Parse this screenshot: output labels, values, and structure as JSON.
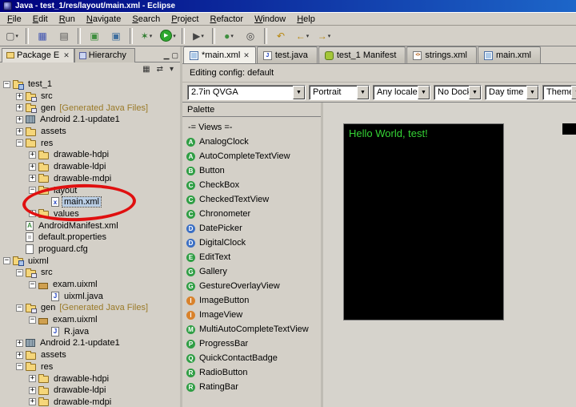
{
  "window": {
    "title": "Java - test_1/res/layout/main.xml - Eclipse"
  },
  "menubar": {
    "items": [
      "File",
      "Edit",
      "Run",
      "Navigate",
      "Search",
      "Project",
      "Refactor",
      "Window",
      "Help"
    ]
  },
  "toolbar": {
    "buttons": [
      {
        "kind": "button",
        "name": "new-wizard-button",
        "glyph": "▢",
        "color": "#555555",
        "dropdown": true
      },
      {
        "kind": "sep",
        "name": "toolbar-separator",
        "interactable": false
      },
      {
        "kind": "button",
        "name": "save-button",
        "glyph": "▦",
        "color": "#3a4fb0"
      },
      {
        "kind": "button",
        "name": "print-button",
        "glyph": "▤",
        "color": "#555555"
      },
      {
        "kind": "sep",
        "name": "toolbar-separator",
        "interactable": false
      },
      {
        "kind": "button",
        "name": "android-sdk-manager-button",
        "glyph": "▣",
        "color": "#3f8f3f"
      },
      {
        "kind": "button",
        "name": "android-avd-manager-button",
        "glyph": "▣",
        "color": "#3f6f9f"
      },
      {
        "kind": "sep",
        "name": "toolbar-separator",
        "interactable": false
      },
      {
        "kind": "button",
        "name": "debug-button",
        "glyph": "✶",
        "color": "#2f7d2f",
        "dropdown": true
      },
      {
        "kind": "button",
        "name": "run-button",
        "glyph": "▶",
        "color": "#ffffff",
        "bg": "#2ea82e",
        "circle": true,
        "dropdown": true
      },
      {
        "kind": "sep",
        "name": "toolbar-separator",
        "interactable": false
      },
      {
        "kind": "button",
        "name": "external-tools-button",
        "glyph": "▶",
        "color": "#444444",
        "dropdown": true
      },
      {
        "kind": "sep",
        "name": "toolbar-separator",
        "interactable": false
      },
      {
        "kind": "button",
        "name": "new-java-element-button",
        "glyph": "●",
        "color": "#3f8f3f",
        "dropdown": true
      },
      {
        "kind": "button",
        "name": "search-button",
        "glyph": "◎",
        "color": "#444444"
      },
      {
        "kind": "sep",
        "name": "toolbar-separator",
        "interactable": false
      },
      {
        "kind": "button",
        "name": "last-edit-location-button",
        "glyph": "↶",
        "color": "#b8860b"
      },
      {
        "kind": "button",
        "name": "back-button",
        "glyph": "←",
        "color": "#b8860b",
        "dropdown": true
      },
      {
        "kind": "button",
        "name": "forward-button",
        "glyph": "→",
        "color": "#b8860b",
        "dropdown": true
      }
    ]
  },
  "package_explorer": {
    "tabs": [
      {
        "label": "Package E",
        "icon": "package-explorer",
        "active": true,
        "close": "✕"
      },
      {
        "label": "Hierarchy",
        "icon": "hierarchy",
        "active": false
      }
    ],
    "controls": [
      {
        "name": "minimize-icon",
        "glyph": "▁"
      },
      {
        "name": "maximize-icon",
        "glyph": "▢"
      }
    ],
    "toolbar": [
      {
        "name": "collapse-all-icon",
        "glyph": "▦"
      },
      {
        "name": "link-with-editor-icon",
        "glyph": "⇄"
      },
      {
        "name": "view-menu-icon",
        "glyph": "▾"
      }
    ],
    "tree": [
      {
        "label": "test_1",
        "depth": 0,
        "expander": "minus",
        "icon": "project"
      },
      {
        "label": "src",
        "depth": 1,
        "expander": "plus",
        "icon": "srcfolder"
      },
      {
        "label": "gen",
        "suffix": "[Generated Java Files]",
        "depth": 1,
        "expander": "plus",
        "icon": "srcfolder"
      },
      {
        "label": "Android 2.1-update1",
        "depth": 1,
        "expander": "plus",
        "icon": "library"
      },
      {
        "label": "assets",
        "depth": 1,
        "expander": "plus",
        "icon": "folder"
      },
      {
        "label": "res",
        "depth": 1,
        "expander": "minus",
        "icon": "folder"
      },
      {
        "label": "drawable-hdpi",
        "depth": 2,
        "expander": "plus",
        "icon": "folder"
      },
      {
        "label": "drawable-ldpi",
        "depth": 2,
        "expander": "plus",
        "icon": "folder"
      },
      {
        "label": "drawable-mdpi",
        "depth": 2,
        "expander": "plus",
        "icon": "folder"
      },
      {
        "label": "layout",
        "depth": 2,
        "expander": "minus",
        "icon": "folder"
      },
      {
        "label": "main.xml",
        "depth": 3,
        "expander": "none",
        "icon": "xml",
        "selected": true
      },
      {
        "label": "values",
        "depth": 2,
        "expander": "plus",
        "icon": "folder"
      },
      {
        "label": "AndroidManifest.xml",
        "depth": 1,
        "expander": "none",
        "icon": "manifest"
      },
      {
        "label": "default.properties",
        "depth": 1,
        "expander": "none",
        "icon": "properties"
      },
      {
        "label": "proguard.cfg",
        "depth": 1,
        "expander": "none",
        "icon": "file"
      },
      {
        "label": "uixml",
        "depth": 0,
        "expander": "minus",
        "icon": "project"
      },
      {
        "label": "src",
        "depth": 1,
        "expander": "minus",
        "icon": "srcfolder"
      },
      {
        "label": "exam.uixml",
        "depth": 2,
        "expander": "minus",
        "icon": "package"
      },
      {
        "label": "uixml.java",
        "depth": 3,
        "expander": "none",
        "icon": "java"
      },
      {
        "label": "gen",
        "suffix": "[Generated Java Files]",
        "depth": 1,
        "expander": "minus",
        "icon": "srcfolder"
      },
      {
        "label": "exam.uixml",
        "depth": 2,
        "expander": "minus",
        "icon": "package"
      },
      {
        "label": "R.java",
        "depth": 3,
        "expander": "none",
        "icon": "java"
      },
      {
        "label": "Android 2.1-update1",
        "depth": 1,
        "expander": "plus",
        "icon": "library"
      },
      {
        "label": "assets",
        "depth": 1,
        "expander": "plus",
        "icon": "folder"
      },
      {
        "label": "res",
        "depth": 1,
        "expander": "minus",
        "icon": "folder"
      },
      {
        "label": "drawable-hdpi",
        "depth": 2,
        "expander": "plus",
        "icon": "folder"
      },
      {
        "label": "drawable-ldpi",
        "depth": 2,
        "expander": "plus",
        "icon": "folder"
      },
      {
        "label": "drawable-mdpi",
        "depth": 2,
        "expander": "plus",
        "icon": "folder"
      }
    ]
  },
  "editor": {
    "tabs": [
      {
        "label": "*main.xml",
        "icon": "layout",
        "active": true,
        "close": "✕"
      },
      {
        "label": "test.java",
        "icon": "java",
        "active": false
      },
      {
        "label": "test_1 Manifest",
        "icon": "android",
        "active": false
      },
      {
        "label": "strings.xml",
        "icon": "xml",
        "active": false
      },
      {
        "label": "main.xml",
        "icon": "layout",
        "active": false
      }
    ],
    "config_label": "Editing config: default",
    "combos": [
      {
        "name": "device-config-combo",
        "value": "2.7in QVGA"
      },
      {
        "name": "orientation-combo",
        "value": "Portrait"
      },
      {
        "name": "locale-combo",
        "value": "Any locale"
      },
      {
        "name": "dock-combo",
        "value": "No Dock"
      },
      {
        "name": "time-combo",
        "value": "Day time"
      },
      {
        "name": "theme-combo",
        "value": "Theme"
      }
    ]
  },
  "palette": {
    "title": "Palette",
    "items": [
      {
        "kind": "header",
        "label": "-= Views =-"
      },
      {
        "kind": "widget",
        "label": "AnalogClock",
        "letter": "A",
        "color": "#2f9e44"
      },
      {
        "kind": "widget",
        "label": "AutoCompleteTextView",
        "letter": "A",
        "color": "#2f9e44"
      },
      {
        "kind": "widget",
        "label": "Button",
        "letter": "B",
        "color": "#2f9e44"
      },
      {
        "kind": "widget",
        "label": "CheckBox",
        "letter": "C",
        "color": "#2f9e44"
      },
      {
        "kind": "widget",
        "label": "CheckedTextView",
        "letter": "C",
        "color": "#2f9e44"
      },
      {
        "kind": "widget",
        "label": "Chronometer",
        "letter": "C",
        "color": "#2f9e44"
      },
      {
        "kind": "widget",
        "label": "DatePicker",
        "letter": "D",
        "color": "#3b6fc4"
      },
      {
        "kind": "widget",
        "label": "DigitalClock",
        "letter": "D",
        "color": "#3b6fc4"
      },
      {
        "kind": "widget",
        "label": "EditText",
        "letter": "E",
        "color": "#2f9e44"
      },
      {
        "kind": "widget",
        "label": "Gallery",
        "letter": "G",
        "color": "#2f9e44"
      },
      {
        "kind": "widget",
        "label": "GestureOverlayView",
        "letter": "G",
        "color": "#2f9e44"
      },
      {
        "kind": "widget",
        "label": "ImageButton",
        "letter": "I",
        "color": "#d9822b"
      },
      {
        "kind": "widget",
        "label": "ImageView",
        "letter": "I",
        "color": "#d9822b"
      },
      {
        "kind": "widget",
        "label": "MultiAutoCompleteTextView",
        "letter": "M",
        "color": "#2f9e44"
      },
      {
        "kind": "widget",
        "label": "ProgressBar",
        "letter": "P",
        "color": "#2f9e44"
      },
      {
        "kind": "widget",
        "label": "QuickContactBadge",
        "letter": "Q",
        "color": "#2f9e44"
      },
      {
        "kind": "widget",
        "label": "RadioButton",
        "letter": "R",
        "color": "#2f9e44"
      },
      {
        "kind": "widget",
        "label": "RatingBar",
        "letter": "R",
        "color": "#2f9e44"
      }
    ]
  },
  "canvas": {
    "hello_text": "Hello World, test!",
    "text_color": "#35d435",
    "screen_bg": "#000000"
  },
  "annotation": {
    "shape": "ellipse",
    "color": "#e01010",
    "target": "main.xml"
  }
}
